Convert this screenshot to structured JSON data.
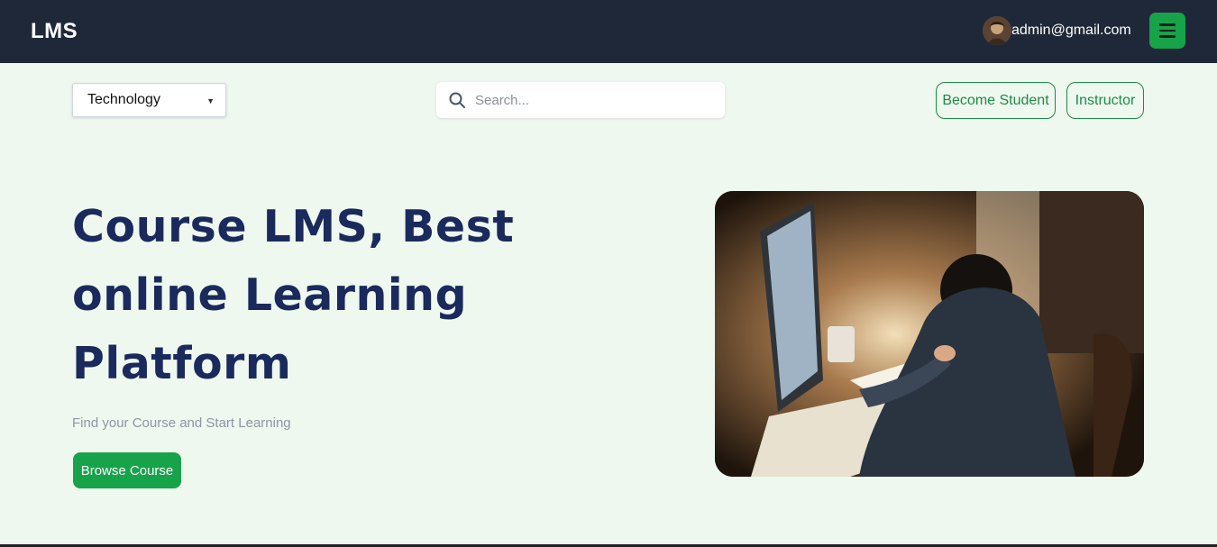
{
  "header": {
    "logo": "LMS",
    "user_email": "admin@gmail.com",
    "menu_icon": "hamburger-icon",
    "accent": "#16a34a",
    "background": "#1f2839"
  },
  "toolbar": {
    "category_selected": "Technology",
    "search_placeholder": "Search...",
    "become_student_label": "Become Student",
    "instructor_label": "Instructor"
  },
  "hero": {
    "title": "Course LMS, Best online Learning Platform",
    "subtitle": "Find your Course and Start Learning",
    "browse_label": "Browse Course"
  }
}
